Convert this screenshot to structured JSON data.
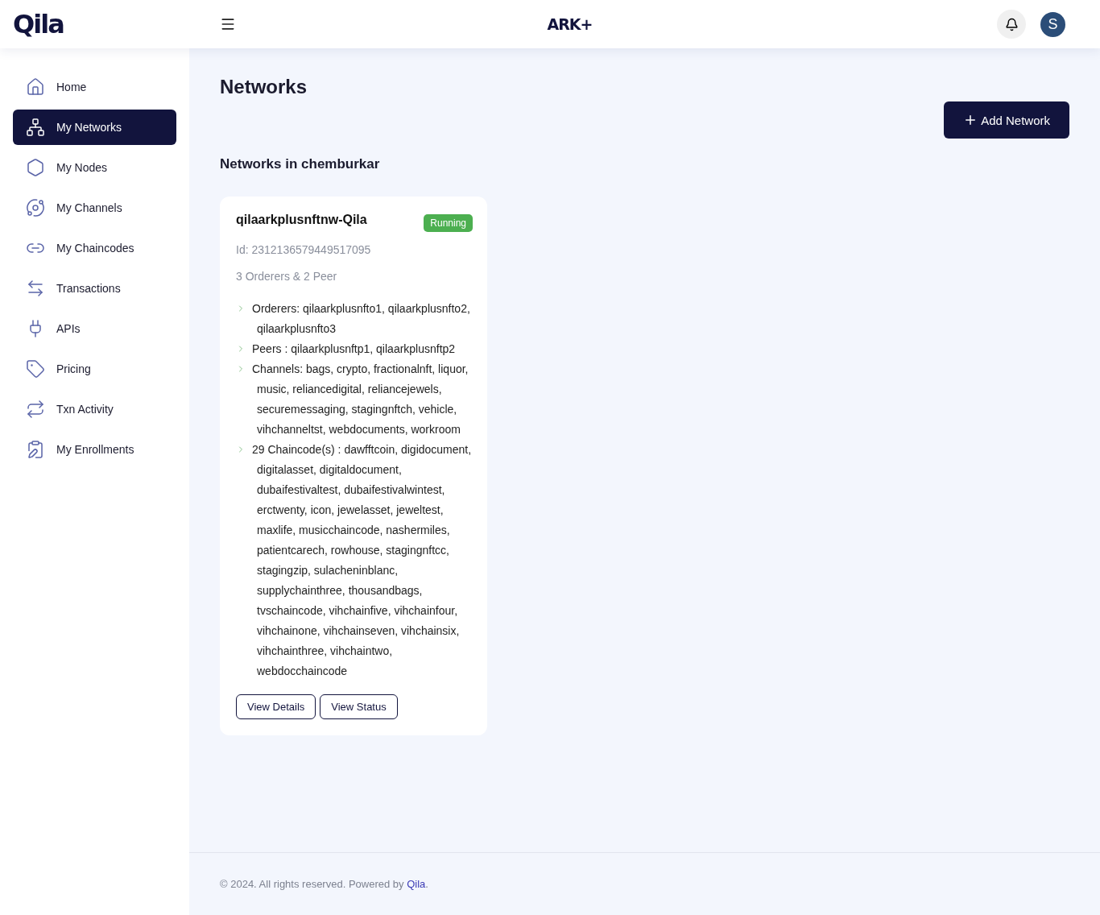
{
  "header": {
    "logo": "Qila",
    "brand": "ARK+",
    "avatar": "S"
  },
  "sidebar": {
    "items": [
      {
        "label": "Home",
        "selected": false
      },
      {
        "label": "My Networks",
        "selected": true
      },
      {
        "label": "My Nodes",
        "selected": false
      },
      {
        "label": "My Channels",
        "selected": false
      },
      {
        "label": "My Chaincodes",
        "selected": false
      },
      {
        "label": "Transactions",
        "selected": false
      },
      {
        "label": "APIs",
        "selected": false
      },
      {
        "label": "Pricing",
        "selected": false
      },
      {
        "label": "Txn Activity",
        "selected": false
      },
      {
        "label": "My Enrollments",
        "selected": false
      }
    ]
  },
  "page": {
    "title": "Networks",
    "add_button": "Add Network",
    "section_title": "Networks in chemburkar"
  },
  "networks": [
    {
      "name": "qilaarkplusnftnw-Qila",
      "status": "Running",
      "id": "Id: 2312136579449517095",
      "summary": "3 Orderers & 2 Peer",
      "details": [
        "Orderers: qilaarkplusnfto1, qilaarkplusnfto2, qilaarkplusnfto3",
        "Peers : qilaarkplusnftp1, qilaarkplusnftp2",
        "Channels: bags, crypto, fractionalnft, liquor, music, reliancedigital, reliancejewels, securemessaging, stagingnftch, vehicle, vihchanneltst, webdocuments, workroom",
        "29 Chaincode(s) : dawfftcoin, digidocument, digitalasset, digitaldocument, dubaifestivaltest, dubaifestivalwintest, erctwenty, icon, jewelasset, jeweltest, maxlife, musicchaincode, nashermiles, patientcarech, rowhouse, stagingnftcc, stagingzip, sulacheninblanc, supplychainthree, thousandbags, tvschaincode, vihchainfive, vihchainfour, vihchainone, vihchainseven, vihchainsix, vihchainthree, vihchaintwo, webdocchaincode"
      ],
      "actions": [
        "View Details",
        "View Status"
      ]
    }
  ],
  "footer": {
    "text": "© 2024. All rights reserved. Powered by ",
    "link": "Qila",
    "end": "."
  }
}
